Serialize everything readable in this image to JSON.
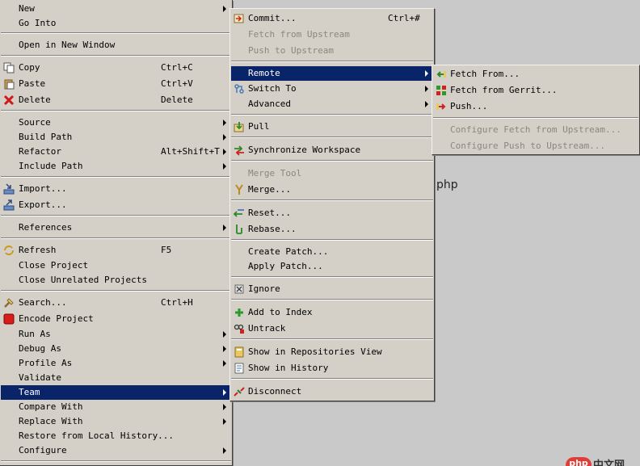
{
  "context_menu": {
    "items": [
      {
        "label": "New",
        "submenu": true
      },
      {
        "label": "Go Into"
      },
      {
        "label": "Open in New Window"
      },
      {
        "label": "Copy",
        "shortcut": "Ctrl+C",
        "icon": "copy-icon"
      },
      {
        "label": "Paste",
        "shortcut": "Ctrl+V",
        "icon": "paste-icon"
      },
      {
        "label": "Delete",
        "shortcut": "Delete",
        "icon": "delete-icon"
      },
      {
        "label": "Source",
        "submenu": true
      },
      {
        "label": "Build Path",
        "submenu": true
      },
      {
        "label": "Refactor",
        "shortcut": "Alt+Shift+T",
        "submenu": true
      },
      {
        "label": "Include Path",
        "submenu": true
      },
      {
        "label": "Import...",
        "icon": "import-icon"
      },
      {
        "label": "Export...",
        "icon": "export-icon"
      },
      {
        "label": "References",
        "submenu": true
      },
      {
        "label": "Refresh",
        "shortcut": "F5",
        "icon": "refresh-icon"
      },
      {
        "label": "Close Project"
      },
      {
        "label": "Close Unrelated Projects"
      },
      {
        "label": "Search...",
        "shortcut": "Ctrl+H",
        "icon": "search-icon"
      },
      {
        "label": "Encode Project",
        "icon": "encode-icon"
      },
      {
        "label": "Run As",
        "submenu": true
      },
      {
        "label": "Debug As",
        "submenu": true
      },
      {
        "label": "Profile As",
        "submenu": true
      },
      {
        "label": "Validate"
      },
      {
        "label": "Team",
        "submenu": true,
        "selected": true
      },
      {
        "label": "Compare With",
        "submenu": true
      },
      {
        "label": "Replace With",
        "submenu": true
      },
      {
        "label": "Restore from Local History..."
      },
      {
        "label": "Configure",
        "submenu": true
      }
    ]
  },
  "team_menu": {
    "items": [
      {
        "label": "Commit...",
        "shortcut": "Ctrl+#",
        "icon": "commit-icon"
      },
      {
        "label": "Fetch from Upstream",
        "disabled": true
      },
      {
        "label": "Push to Upstream",
        "disabled": true
      },
      {
        "label": "Remote",
        "submenu": true,
        "selected": true
      },
      {
        "label": "Switch To",
        "submenu": true,
        "icon": "switch-icon"
      },
      {
        "label": "Advanced",
        "submenu": true
      },
      {
        "label": "Pull",
        "icon": "pull-icon"
      },
      {
        "label": "Synchronize Workspace",
        "icon": "sync-icon"
      },
      {
        "label": "Merge Tool",
        "disabled": true
      },
      {
        "label": "Merge...",
        "icon": "merge-icon"
      },
      {
        "label": "Reset...",
        "icon": "reset-icon"
      },
      {
        "label": "Rebase...",
        "icon": "rebase-icon"
      },
      {
        "label": "Create Patch..."
      },
      {
        "label": "Apply Patch..."
      },
      {
        "label": "Ignore",
        "icon": "ignore-icon"
      },
      {
        "label": "Add to Index",
        "icon": "add-icon"
      },
      {
        "label": "Untrack",
        "icon": "untrack-icon"
      },
      {
        "label": "Show in Repositories View",
        "icon": "repository-icon"
      },
      {
        "label": "Show in History",
        "icon": "history-icon"
      },
      {
        "label": "Disconnect",
        "icon": "disconnect-icon"
      }
    ]
  },
  "remote_menu": {
    "items": [
      {
        "label": "Fetch From...",
        "icon": "fetch-icon"
      },
      {
        "label": "Fetch from Gerrit...",
        "icon": "gerrit-icon"
      },
      {
        "label": "Push...",
        "icon": "push-icon"
      },
      {
        "label": "Configure Fetch from Upstream...",
        "disabled": true
      },
      {
        "label": "Configure Push to Upstream...",
        "disabled": true
      }
    ]
  },
  "background_text": "php",
  "watermark": {
    "badge": "php",
    "text": "中文网"
  }
}
